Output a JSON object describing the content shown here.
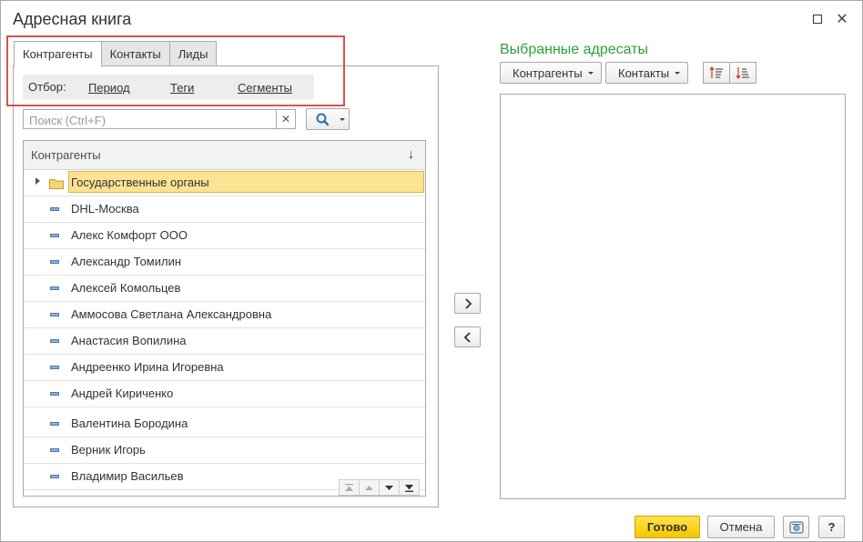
{
  "window": {
    "title": "Адресная книга",
    "maximize_icon": "maximize-icon",
    "close_icon": "close-icon"
  },
  "tabs": [
    {
      "label": "Контрагенты",
      "active": true
    },
    {
      "label": "Контакты",
      "active": false
    },
    {
      "label": "Лиды",
      "active": false
    }
  ],
  "filter": {
    "label": "Отбор:",
    "links": [
      "Период",
      "Теги",
      "Сегменты"
    ]
  },
  "search": {
    "placeholder": "Поиск (Ctrl+F)",
    "value": "",
    "clear_icon": "clear-icon",
    "search_icon": "search-icon"
  },
  "list": {
    "header": "Контрагенты",
    "sort_icon": "↓",
    "rows": [
      {
        "label": "Государственные органы",
        "type": "group",
        "selected": true
      },
      {
        "label": "DHL-Москва",
        "type": "item"
      },
      {
        "label": "Алекс Комфорт ООО",
        "type": "item"
      },
      {
        "label": "Александр Томилин",
        "type": "item"
      },
      {
        "label": "Алексей Комольцев",
        "type": "item"
      },
      {
        "label": "Аммосова Светлана Александровна",
        "type": "item"
      },
      {
        "label": "Анастасия Вопилина",
        "type": "item"
      },
      {
        "label": "Андреенко Ирина Игоревна",
        "type": "item"
      },
      {
        "label": "Андрей Кириченко",
        "type": "item"
      },
      {
        "label": "Валентина Бородина",
        "type": "item"
      },
      {
        "label": "Верник Игорь",
        "type": "item"
      },
      {
        "label": "Владимир Васильев",
        "type": "item"
      }
    ]
  },
  "right": {
    "title": "Выбранные адресаты",
    "filter_buttons": [
      "Контрагенты",
      "Контакты"
    ]
  },
  "footer": {
    "done_label": "Готово",
    "cancel_label": "Отмена",
    "help_label": "?"
  },
  "colors": {
    "accent_green": "#2aa139",
    "selection": "#fbe393",
    "primary_button": "#f5c600",
    "highlight_frame": "#d9534f"
  }
}
